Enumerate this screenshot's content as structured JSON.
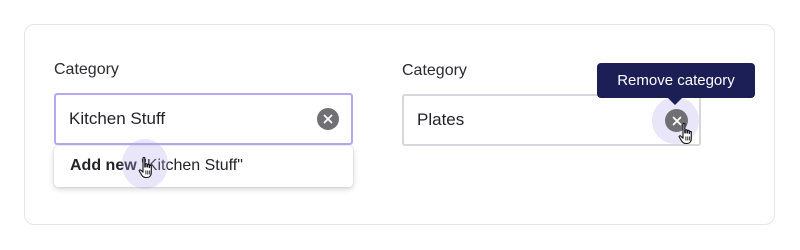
{
  "left_field": {
    "label": "Category",
    "value": "Kitchen Stuff",
    "clear_icon": "close-icon",
    "dropdown": {
      "action_label": "Add new",
      "quoted_value": "\"Kitchen Stuff\""
    }
  },
  "right_field": {
    "label": "Category",
    "value": "Plates",
    "clear_icon": "close-icon",
    "tooltip": "Remove category"
  },
  "colors": {
    "focus_border": "#b7a8f0",
    "tooltip_bg": "#1b1f55",
    "clear_button": "#6f6f74",
    "halo": "#b2a6eb"
  }
}
